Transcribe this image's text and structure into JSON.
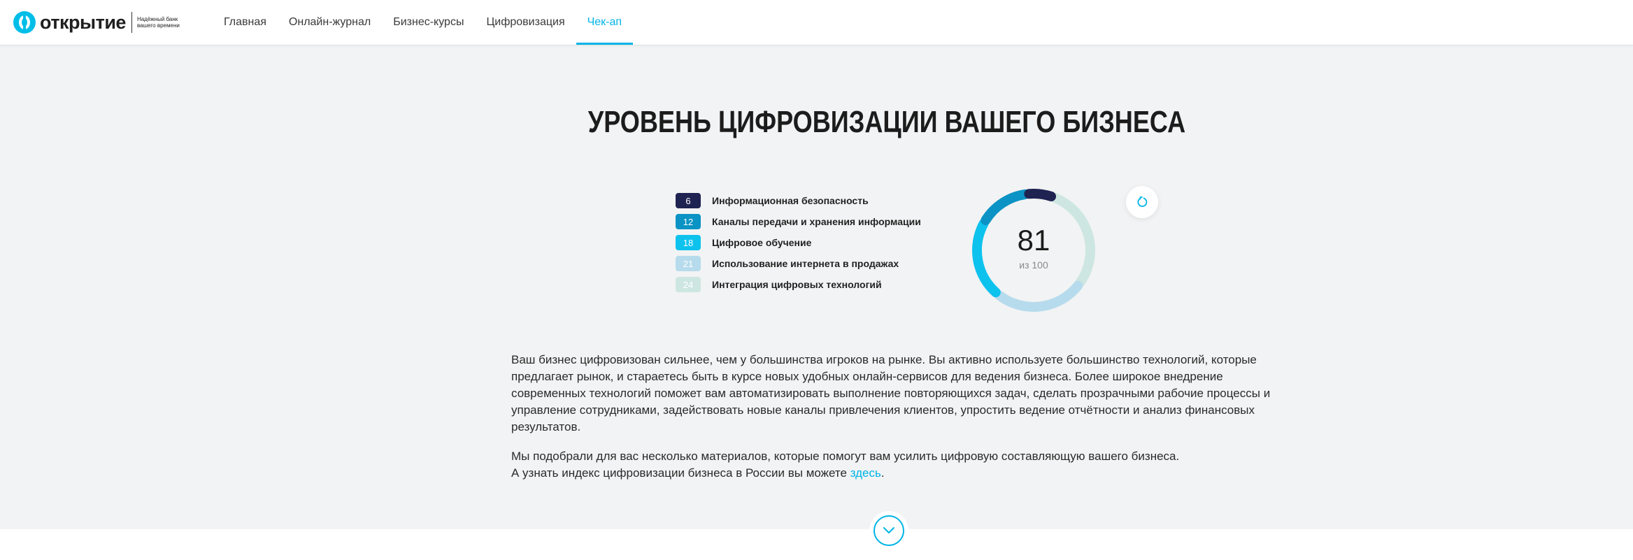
{
  "header": {
    "logo_text": "открытие",
    "logo_slogan": "Надёжный банк вашего времени",
    "nav": [
      {
        "label": "Главная",
        "active": false
      },
      {
        "label": "Онлайн-журнал",
        "active": false
      },
      {
        "label": "Бизнес-курсы",
        "active": false
      },
      {
        "label": "Цифровизация",
        "active": false
      },
      {
        "label": "Чек-ап",
        "active": true
      }
    ]
  },
  "main": {
    "title": "УРОВЕНЬ ЦИФРОВИЗАЦИИ ВАШЕГО БИЗНЕСА",
    "score": "81",
    "score_sub": "из 100",
    "paragraph1": "Ваш бизнес цифровизован сильнее, чем у большинства игроков на рынке. Вы активно используете большинство технологий, которые предлагает рынок, и стараетесь быть в курсе новых удобных онлайн-сервисов для ведения бизнеса. Более широкое внедрение современных технологий поможет вам автоматизировать выполнение повторяющихся задач, сделать прозрачными рабочие процессы и управление сотрудниками, задействовать новые каналы привлечения клиентов, упростить ведение отчётности и анализ финансовых результатов.",
    "paragraph2_line1": "Мы подобрали для вас несколько материалов, которые помогут вам усилить цифровую составляющую вашего бизнеса.",
    "paragraph2_line2": "А узнать индекс цифровизации бизнеса в России вы можете ",
    "link_text": "здесь",
    "paragraph2_end": "."
  },
  "chart_data": {
    "type": "pie",
    "title": "",
    "total": 81,
    "max": 100,
    "series": [
      {
        "name": "Информационная безопасность",
        "value": 6,
        "color": "#1f2352"
      },
      {
        "name": "Каналы передачи и хранения информации",
        "value": 12,
        "color": "#0a93c4"
      },
      {
        "name": "Цифровое обучение",
        "value": 18,
        "color": "#0ec2ee"
      },
      {
        "name": "Использование интернета в продажах",
        "value": 21,
        "color": "#b6dbec"
      },
      {
        "name": "Интеграция цифровых технологий",
        "value": 24,
        "color": "#cde6e1"
      }
    ]
  },
  "icons": {
    "refresh": "refresh-icon",
    "scroll_down": "chevron-down-icon"
  }
}
